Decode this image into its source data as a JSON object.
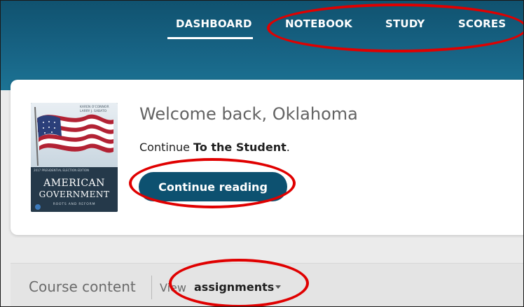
{
  "nav": {
    "items": [
      {
        "label": "DASHBOARD"
      },
      {
        "label": "NOTEBOOK"
      },
      {
        "label": "STUDY"
      },
      {
        "label": "SCORES"
      }
    ],
    "active": "DASHBOARD"
  },
  "book": {
    "authors_line1": "KAREN O'CONNOR",
    "authors_line2": "LARRY J. SABATO",
    "edition": "2017 PRESIDENTIAL ELECTION EDITION",
    "title_line1": "AMERICAN",
    "title_line2": "GOVERNMENT",
    "subtitle": "ROOTS AND REFORM"
  },
  "welcome": {
    "greeting": "Welcome back, Oklahoma",
    "continue_prefix": "Continue ",
    "continue_target": "To the Student",
    "continue_suffix": ".",
    "button_label": "Continue reading"
  },
  "course": {
    "title": "Course content",
    "view_label": "View",
    "view_selected": "assignments"
  },
  "colors": {
    "header": "#176384",
    "button": "#0d5170",
    "annotation": "#e00000"
  }
}
